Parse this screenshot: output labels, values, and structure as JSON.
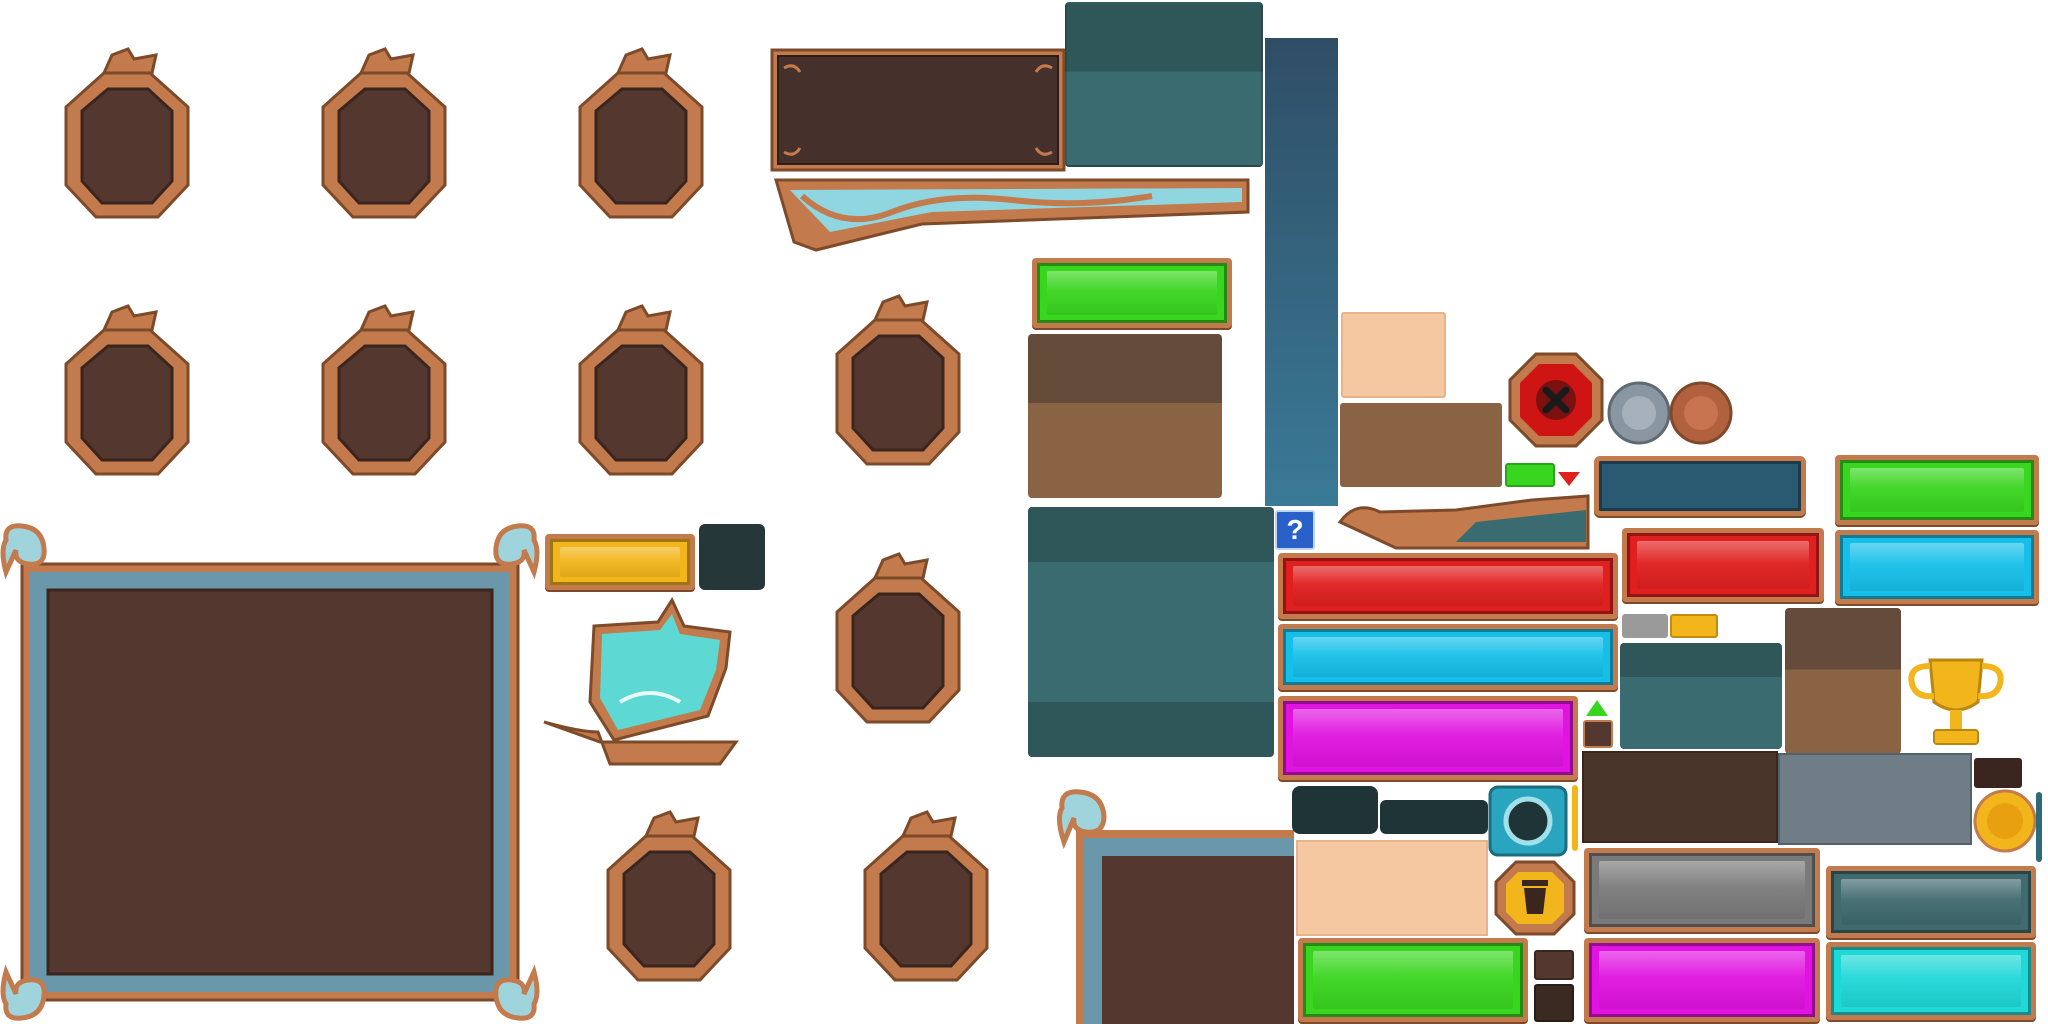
{
  "sheet": {
    "title": "",
    "background": "#ffffff"
  },
  "palette": {
    "bronze": "#c37a4c",
    "bronze_dark": "#7d4a2a",
    "wood_dark": "#54382f",
    "teal_dark": "#2f5659",
    "teal": "#3a6b70",
    "sky": "#3a7a97",
    "sand": "#f6c8a1",
    "brown": "#8a6344",
    "green": "#39d61f",
    "red": "#e01f1f",
    "cyan": "#16bfe9",
    "magenta": "#e013e0",
    "gray": "#7a7a7a",
    "gold": "#f2b61c",
    "ice": "#8fd6e0"
  },
  "icons": {
    "help_glyph": "?",
    "close_glyph": "✕"
  },
  "sprites": {
    "plaques": [
      "plaque-frame",
      "plaque-frame",
      "plaque-frame",
      "plaque-frame",
      "plaque-frame",
      "plaque-frame",
      "plaque-frame",
      "plaque-frame",
      "plaque-frame",
      "plaque-frame"
    ],
    "buttons": [
      "green",
      "red",
      "cyan",
      "magenta",
      "gray",
      "teal",
      "aqua"
    ]
  }
}
